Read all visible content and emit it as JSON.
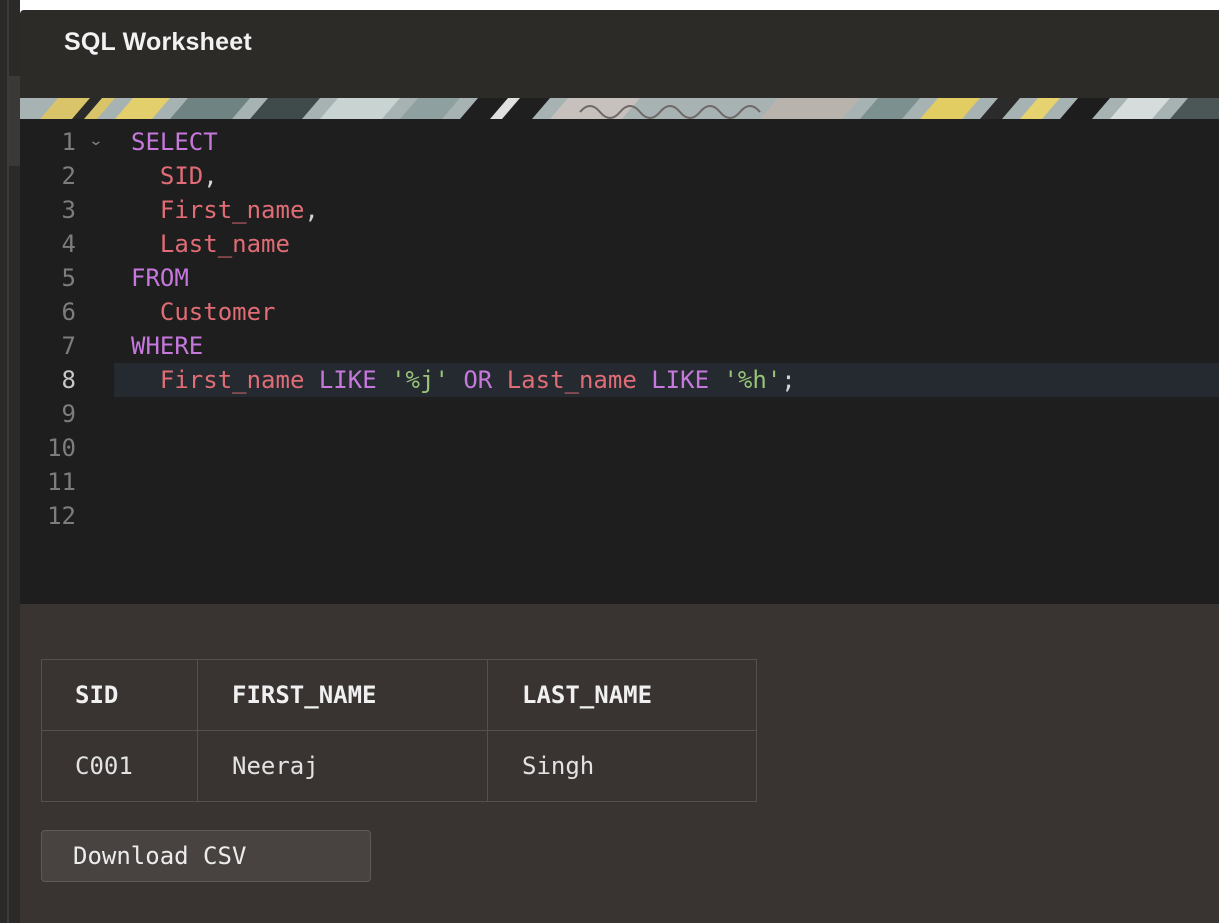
{
  "header": {
    "title": "SQL Worksheet"
  },
  "editor": {
    "lines": [
      {
        "number": "1",
        "foldable": true,
        "tokens": [
          {
            "t": "SELECT",
            "k": "kw"
          }
        ]
      },
      {
        "number": "2",
        "tokens": [
          {
            "t": "  ",
            "k": "pun"
          },
          {
            "t": "SID",
            "k": "id"
          },
          {
            "t": ",",
            "k": "pun"
          }
        ]
      },
      {
        "number": "3",
        "tokens": [
          {
            "t": "  ",
            "k": "pun"
          },
          {
            "t": "First_name",
            "k": "id"
          },
          {
            "t": ",",
            "k": "pun"
          }
        ]
      },
      {
        "number": "4",
        "tokens": [
          {
            "t": "  ",
            "k": "pun"
          },
          {
            "t": "Last_name",
            "k": "id"
          }
        ]
      },
      {
        "number": "5",
        "tokens": [
          {
            "t": "FROM",
            "k": "kw"
          }
        ]
      },
      {
        "number": "6",
        "tokens": [
          {
            "t": "  ",
            "k": "pun"
          },
          {
            "t": "Customer",
            "k": "id"
          }
        ]
      },
      {
        "number": "7",
        "tokens": [
          {
            "t": "WHERE",
            "k": "kw"
          }
        ]
      },
      {
        "number": "8",
        "active": true,
        "tokens": [
          {
            "t": "  ",
            "k": "pun"
          },
          {
            "t": "First_name",
            "k": "id"
          },
          {
            "t": " ",
            "k": "pun"
          },
          {
            "t": "LIKE",
            "k": "kw"
          },
          {
            "t": " ",
            "k": "pun"
          },
          {
            "t": "'%j'",
            "k": "str"
          },
          {
            "t": " ",
            "k": "pun"
          },
          {
            "t": "OR",
            "k": "kw"
          },
          {
            "t": " ",
            "k": "pun"
          },
          {
            "t": "Last_name",
            "k": "id"
          },
          {
            "t": " ",
            "k": "pun"
          },
          {
            "t": "LIKE",
            "k": "kw"
          },
          {
            "t": " ",
            "k": "pun"
          },
          {
            "t": "'%h'",
            "k": "str"
          },
          {
            "t": ";",
            "k": "pun"
          }
        ]
      },
      {
        "number": "9",
        "tokens": []
      },
      {
        "number": "10",
        "tokens": []
      },
      {
        "number": "11",
        "tokens": []
      },
      {
        "number": "12",
        "tokens": []
      }
    ],
    "fold_icon": "chevron-down-icon",
    "colors": {
      "keyword": "#c678dd",
      "identifier": "#e06c75",
      "string": "#98c379"
    }
  },
  "results": {
    "columns": [
      "SID",
      "FIRST_NAME",
      "LAST_NAME"
    ],
    "rows": [
      [
        "C001",
        "Neeraj",
        "Singh"
      ]
    ],
    "download_label": "Download CSV"
  }
}
